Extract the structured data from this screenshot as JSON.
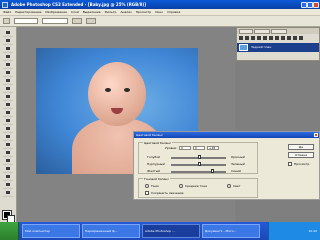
{
  "app": {
    "title": "Adobe Photoshop CS3 Extended - [Baby.jpg @ 25% (RGB/8)]",
    "menu": [
      "Файл",
      "Редактирование",
      "Изображение",
      "Слой",
      "Выделение",
      "Фильтр",
      "Анализ",
      "Просмотр",
      "Окно",
      "Справка"
    ]
  },
  "layers_panel": {
    "tabs": [
      "Слои",
      "Каналы",
      "Контуры"
    ],
    "layer_name": "Задний план"
  },
  "dialog": {
    "title": "Цветовой баланс",
    "group_color_balance_label": "Цветовой баланс",
    "levels_label": "Уровни:",
    "levels": [
      "0",
      "0",
      "+16"
    ],
    "rows": [
      {
        "left": "Голубой",
        "right": "Красный"
      },
      {
        "left": "Пурпурный",
        "right": "Зеленый"
      },
      {
        "left": "Желтый",
        "right": "Синий"
      }
    ],
    "group_tone_label": "Тоновой баланс",
    "tone_options": [
      "Тени",
      "Средние тона",
      "Свет"
    ],
    "preserve_luminosity": "Сохранить свечение",
    "buttons": {
      "ok": "Да",
      "cancel": "Отмена",
      "preview": "Просмотр"
    }
  },
  "taskbar": {
    "start": "",
    "items": [
      "Мой компьютер",
      "Неразрешенный ф...",
      "Adobe Photoshop ...",
      "Документ1 - Micro..."
    ],
    "clock": "10:42"
  },
  "colors": {
    "accent": "#0b5bd8",
    "layer_selected": "#1b3f8c",
    "taskbar": "#2459d6"
  }
}
